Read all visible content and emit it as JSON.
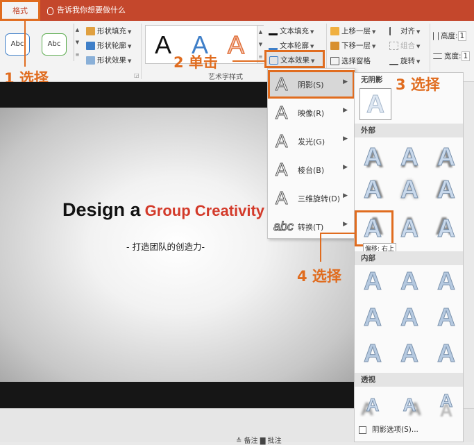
{
  "header": {
    "active_tab": "格式",
    "tell_me": "告诉我你想要做什么"
  },
  "ribbon": {
    "shape_styles": [
      "Abc",
      "Abc"
    ],
    "shape_fill": "形状填充",
    "shape_outline": "形状轮廓",
    "shape_effects": "形状效果",
    "gallery_letters": [
      "A",
      "A",
      "A"
    ],
    "text_fill": "文本填充",
    "text_outline": "文本轮廓",
    "text_effects": "文本效果",
    "bring_forward": "上移一层",
    "send_backward": "下移一层",
    "selection_pane": "选择窗格",
    "align": "对齐",
    "group": "组合",
    "rotate": "旋转",
    "height_label": "高度:",
    "width_label": "宽度:",
    "height_value": "1",
    "width_value": "1",
    "art_group_label": "艺术字样式"
  },
  "callouts": {
    "step1": "1 选择",
    "step2": "2 单击",
    "step3": "3 选择",
    "step4": "4 选择"
  },
  "slide": {
    "title_part1": "Design a",
    "title_part2": "Group Creativity",
    "subtitle": "- 打造团队的创造力-"
  },
  "text_effects_menu": {
    "items": [
      {
        "label": "阴影(S)",
        "icon": "A"
      },
      {
        "label": "映像(R)",
        "icon": "A"
      },
      {
        "label": "发光(G)",
        "icon": "A"
      },
      {
        "label": "棱台(B)",
        "icon": "A"
      },
      {
        "label": "三维旋转(D)",
        "icon": "A"
      },
      {
        "label": "转换(T)",
        "icon": "abc"
      }
    ]
  },
  "shadow_submenu": {
    "no_shadow": "无阴影",
    "outer": "外部",
    "inner": "内部",
    "perspective": "透视",
    "tooltip": "偏移: 右上",
    "shadow_options": "阴影选项(S)...",
    "letter": "A"
  },
  "status_bar": {
    "text": "≙ 备注   ▇ 批注"
  },
  "colors": {
    "accent": "#c4472c",
    "callout": "#e06c1f",
    "title_red": "#d33a2a"
  }
}
